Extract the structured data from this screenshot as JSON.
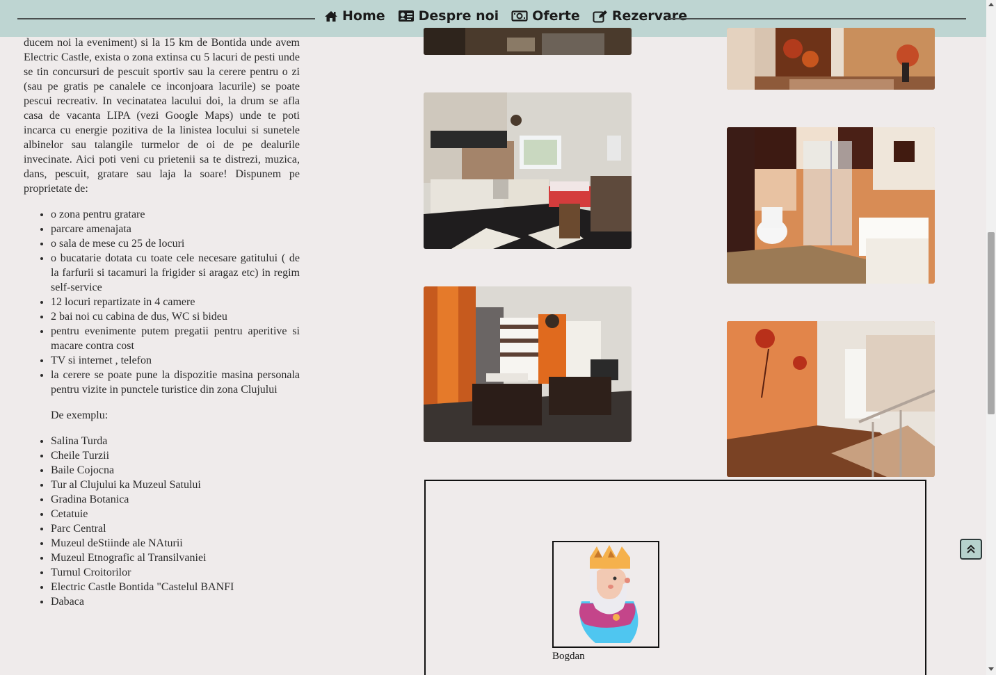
{
  "nav": {
    "items": [
      {
        "label": "Home",
        "icon": "home-icon"
      },
      {
        "label": "Despre noi",
        "icon": "id-card-icon"
      },
      {
        "label": "Oferte",
        "icon": "money-bill-icon"
      },
      {
        "label": "Rezervare",
        "icon": "edit-icon"
      }
    ],
    "bg_color": "#bed5d2"
  },
  "content": {
    "intro_paragraph": "ducem noi la eveniment) si la 15 km de Bontida unde avem Electric Castle, exista o zona extinsa cu 5 lacuri de pesti unde se tin concursuri de pescuit sportiv sau la cerere pentru o zi (sau pe gratis pe canalele ce inconjoara lacurile) se poate pescui recreativ. In vecinatatea lacului doi, la drum se afla casa de vacanta LIPA (vezi Google Maps) unde te poti incarca cu energie pozitiva de la linistea locului si sunetele albinelor sau talangile turmelor de oi de pe dealurile invecinate. Aici poti veni cu prietenii sa te distrezi, muzica, dans, pescuit, gratare sau laja la soare! Dispunem pe proprietate de:",
    "amenities": [
      "o zona pentru gratare",
      "parcare amenajata",
      "o sala de mese cu 25 de locuri",
      "o bucatarie dotata cu toate cele necesare gatitului ( de la farfurii si tacamuri la frigider si aragaz etc) in regim self-service",
      "12 locuri repartizate in 4 camere",
      "2 bai noi cu cabina de dus, WC si bideu",
      "pentru evenimente putem pregatii pentru aperitive si macare contra cost",
      "TV si internet , telefon",
      "la cerere se poate pune la dispozitie masina personala pentru vizite in punctele turistice din zona Clujului"
    ],
    "example_label": "De exemplu:",
    "places": [
      "Salina Turda",
      "Cheile Turzii",
      "Baile Cojocna",
      "Tur al Clujului ka Muzeul Satului",
      "Gradina Botanica",
      "Cetatuie",
      "Parc Central",
      "Muzeul deStiinde ale NAturii",
      "Muzeul Etnografic al Transilvaniei",
      "Turnul Croitorilor",
      "Electric Castle Bontida \"Castelul BANFI",
      "Dabaca"
    ]
  },
  "gallery": {
    "photos": [
      {
        "subject": "room-top-left"
      },
      {
        "subject": "living-room-top-right"
      },
      {
        "subject": "kitchen"
      },
      {
        "subject": "bathroom"
      },
      {
        "subject": "dining-room"
      },
      {
        "subject": "hallway-stairs"
      }
    ]
  },
  "review": {
    "avatar_icon": "king-avatar-icon",
    "name": "Bogdan"
  },
  "back_to_top": {
    "icon": "double-chevron-up-icon"
  }
}
